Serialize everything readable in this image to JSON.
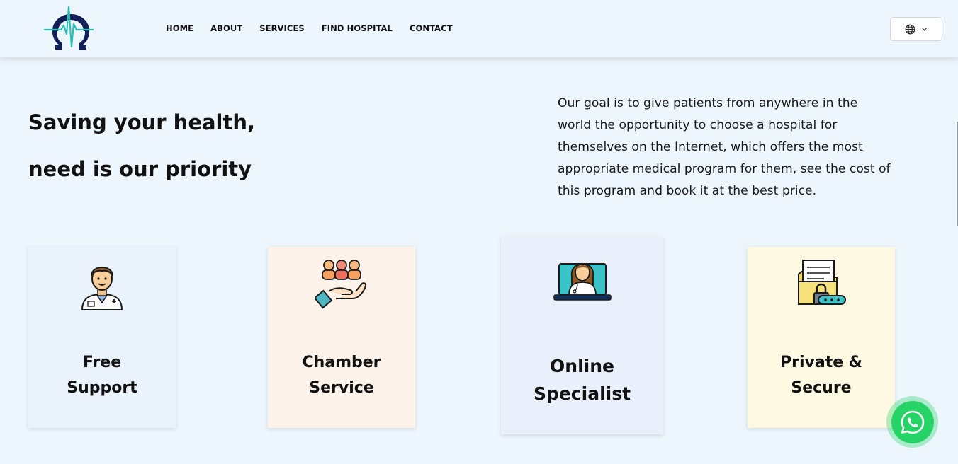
{
  "nav": {
    "items": [
      {
        "label": "HOME"
      },
      {
        "label": "ABOUT"
      },
      {
        "label": "SERVICES"
      },
      {
        "label": "FIND HOSPITAL"
      },
      {
        "label": "CONTACT"
      }
    ],
    "language_icon": "globe-icon",
    "language_chevron": "chevron-down-icon"
  },
  "hero": {
    "title_line1": "Saving your health,",
    "title_line2": "need is our priority",
    "description": "Our goal is to give patients from anywhere in the world the opportunity to choose a hospital for themselves on the Internet, which offers the most appropriate medical program for them, see the cost of this program and book it at the best price."
  },
  "features": [
    {
      "line1": "Free",
      "line2": "Support",
      "icon": "doctor-icon",
      "bg": "#eaf2fc"
    },
    {
      "line1": "Chamber",
      "line2": "Service",
      "icon": "hand-people-icon",
      "bg": "#fdf3ea"
    },
    {
      "line1": "Online",
      "line2": "Specialist",
      "icon": "laptop-doctor-icon",
      "bg": "#eaf0fb"
    },
    {
      "line1": "Private &",
      "line2": "Secure",
      "icon": "secure-folder-icon",
      "bg": "#fdf9e2"
    }
  ],
  "colors": {
    "page_bg": "#eef6fd",
    "logo_navy": "#12205a",
    "logo_teal": "#2bbfb3",
    "whatsapp": "#25d366"
  },
  "whatsapp_icon": "whatsapp-icon"
}
